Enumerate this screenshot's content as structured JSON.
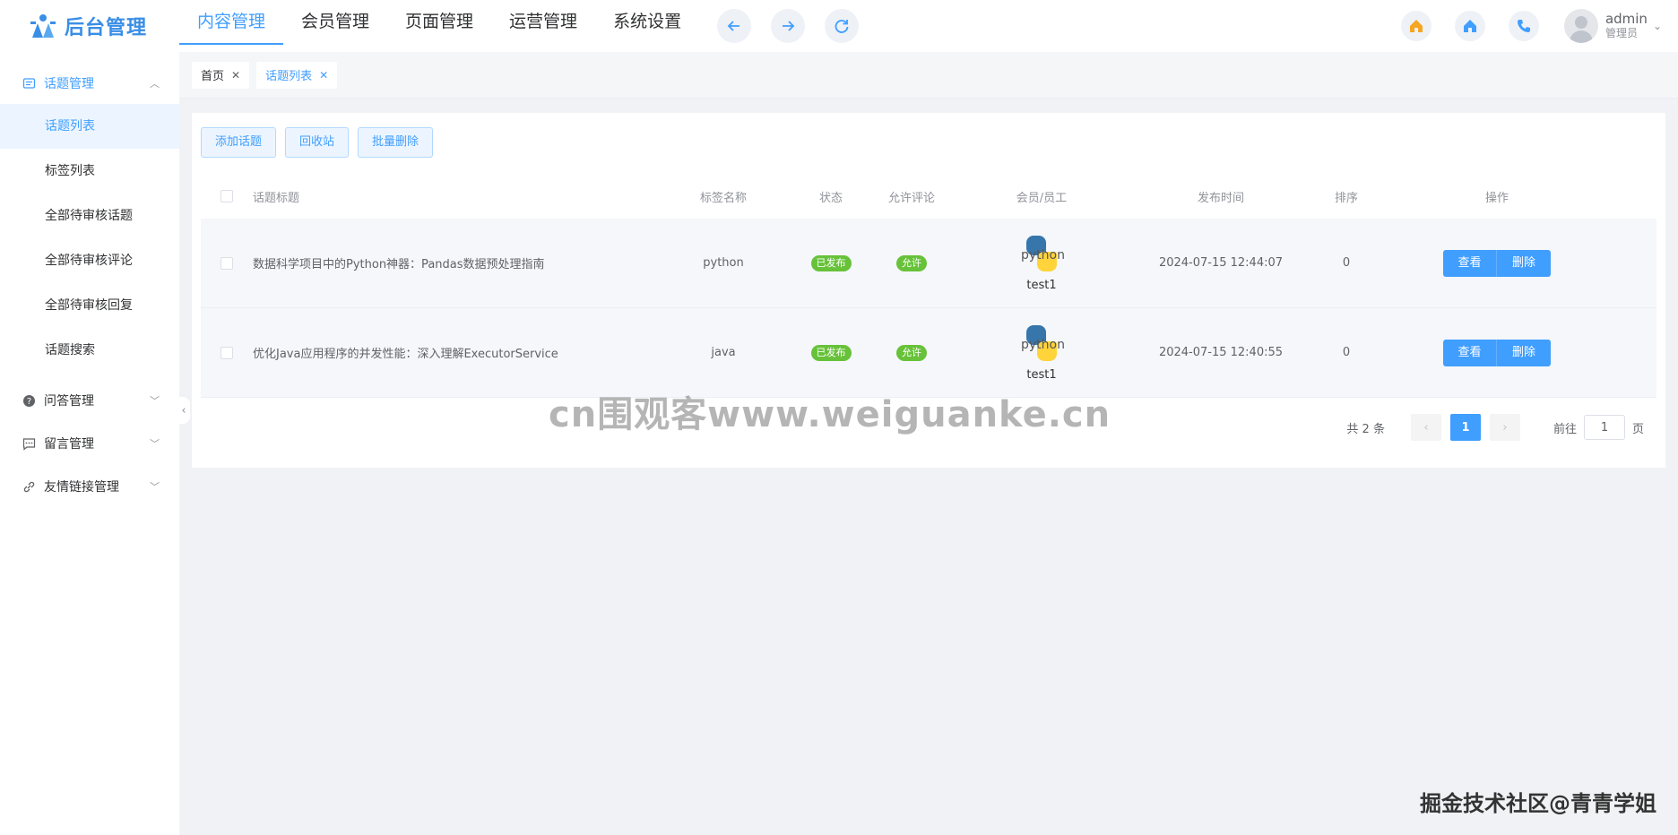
{
  "app": {
    "logo_text": "后台管理"
  },
  "topnav": {
    "items": [
      "内容管理",
      "会员管理",
      "页面管理",
      "运营管理",
      "系统设置"
    ],
    "active": 0
  },
  "user": {
    "name": "admin",
    "role": "管理员"
  },
  "sidebar": {
    "groups": [
      {
        "label": "话题管理",
        "icon": "message-icon",
        "open": true,
        "items": [
          "话题列表",
          "标签列表",
          "全部待审核话题",
          "全部待审核评论",
          "全部待审核回复",
          "话题搜索"
        ],
        "active_item": 0
      },
      {
        "label": "问答管理",
        "icon": "question-icon"
      },
      {
        "label": "留言管理",
        "icon": "chat-icon"
      },
      {
        "label": "友情链接管理",
        "icon": "link-icon"
      }
    ]
  },
  "tabs": [
    {
      "label": "首页",
      "active": false
    },
    {
      "label": "话题列表",
      "active": true
    }
  ],
  "toolbar": {
    "add": "添加话题",
    "recycle": "回收站",
    "batch_delete": "批量删除"
  },
  "table": {
    "headers": {
      "title": "话题标题",
      "tag": "标签名称",
      "status": "状态",
      "allow": "允许评论",
      "member": "会员/员工",
      "time": "发布时间",
      "sort": "排序",
      "op": "操作"
    },
    "rows": [
      {
        "title": "数据科学项目中的Python神器：Pandas数据预处理指南",
        "tag": "python",
        "status": "已发布",
        "allow": "允许",
        "avatar_text": "python",
        "member": "test1",
        "time": "2024-07-15 12:44:07",
        "sort": "0",
        "view": "查看",
        "delete": "删除"
      },
      {
        "title": "优化Java应用程序的并发性能：深入理解ExecutorService",
        "tag": "java",
        "status": "已发布",
        "allow": "允许",
        "avatar_text": "python",
        "member": "test1",
        "time": "2024-07-15 12:40:55",
        "sort": "0",
        "view": "查看",
        "delete": "删除"
      }
    ]
  },
  "pagination": {
    "total": "共 2 条",
    "current": "1",
    "goto_prefix": "前往",
    "goto_value": "1",
    "goto_suffix": "页"
  },
  "watermark": "cn围观客www.weiguanke.cn",
  "corner_watermark": "掘金技术社区@青青学姐",
  "colors": {
    "primary": "#409eff",
    "success": "#67c23a"
  }
}
